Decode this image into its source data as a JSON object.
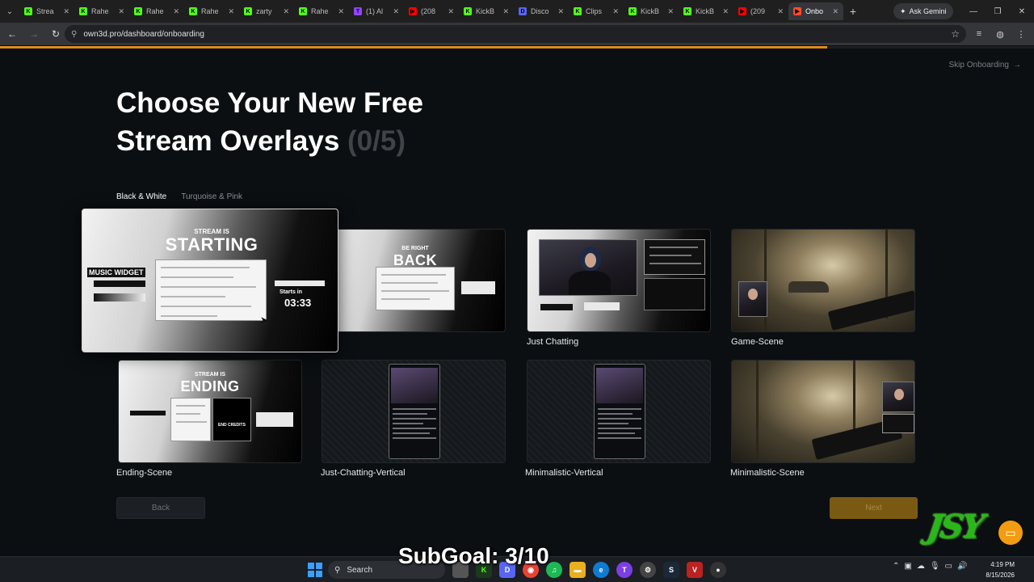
{
  "browser": {
    "tabs": [
      {
        "title": "Strea",
        "fav_color": "#53fc18",
        "fav_char": "K"
      },
      {
        "title": "Rahe",
        "fav_color": "#53fc18",
        "fav_char": "K"
      },
      {
        "title": "Rahe",
        "fav_color": "#53fc18",
        "fav_char": "K"
      },
      {
        "title": "Rahe",
        "fav_color": "#53fc18",
        "fav_char": "K"
      },
      {
        "title": "zarty",
        "fav_color": "#53fc18",
        "fav_char": "K"
      },
      {
        "title": "Rahe",
        "fav_color": "#53fc18",
        "fav_char": "K"
      },
      {
        "title": "(1) Al",
        "fav_color": "#9146ff",
        "fav_char": "T"
      },
      {
        "title": "(208",
        "fav_color": "#ff0000",
        "fav_char": "▶"
      },
      {
        "title": "KickB",
        "fav_color": "#53fc18",
        "fav_char": "K"
      },
      {
        "title": "Disco",
        "fav_color": "#5865f2",
        "fav_char": "D"
      },
      {
        "title": "Clips",
        "fav_color": "#53fc18",
        "fav_char": "K"
      },
      {
        "title": "KickB",
        "fav_color": "#53fc18",
        "fav_char": "K"
      },
      {
        "title": "KickB",
        "fav_color": "#53fc18",
        "fav_char": "K"
      },
      {
        "title": "(209",
        "fav_color": "#ff0000",
        "fav_char": "▶"
      },
      {
        "title": "Onbo",
        "fav_color": "#ff4b2b",
        "fav_char": "▶",
        "active": true
      }
    ],
    "ask_gemini": "Ask Gemini",
    "url": "own3d.pro/dashboard/onboarding",
    "progress_fraction": 0.8
  },
  "page": {
    "skip_label": "Skip Onboarding",
    "title_line1": "Choose Your New Free",
    "title_line2": "Stream Overlays",
    "title_count": "(0/5)",
    "theme_tabs": [
      {
        "label": "Black & White",
        "active": true
      },
      {
        "label": "Turquoise & Pink",
        "active": false
      }
    ],
    "overlays": {
      "starting": {
        "small": "STREAM IS",
        "big": "STARTING",
        "widget": "MUSIC WIDGET",
        "starts_in": "Starts in",
        "time": "03:33"
      },
      "brb": {
        "small": "BE RIGHT",
        "big": "BACK"
      },
      "just_chatting": {
        "label": "Just Chatting"
      },
      "game": {
        "label": "Game-Scene"
      },
      "ending": {
        "small": "STREAM IS",
        "big": "ENDING",
        "credits": "END CREDITS",
        "label": "Ending-Scene"
      },
      "jc_vertical": {
        "label": "Just-Chatting-Vertical"
      },
      "min_vertical": {
        "label": "Minimalistic-Vertical"
      },
      "min_scene": {
        "label": "Minimalistic-Scene"
      }
    },
    "back_label": "Back",
    "next_label": "Next",
    "brand_logo_text": "JSY"
  },
  "overlay_text": {
    "subgoal": "SubGoal: 3/10"
  },
  "taskbar": {
    "search_placeholder": "Search",
    "time": "4:19 PM",
    "date": "8/15/2026"
  },
  "colors": {
    "accent": "#e08a1e",
    "next_button": "#7a5a12"
  }
}
